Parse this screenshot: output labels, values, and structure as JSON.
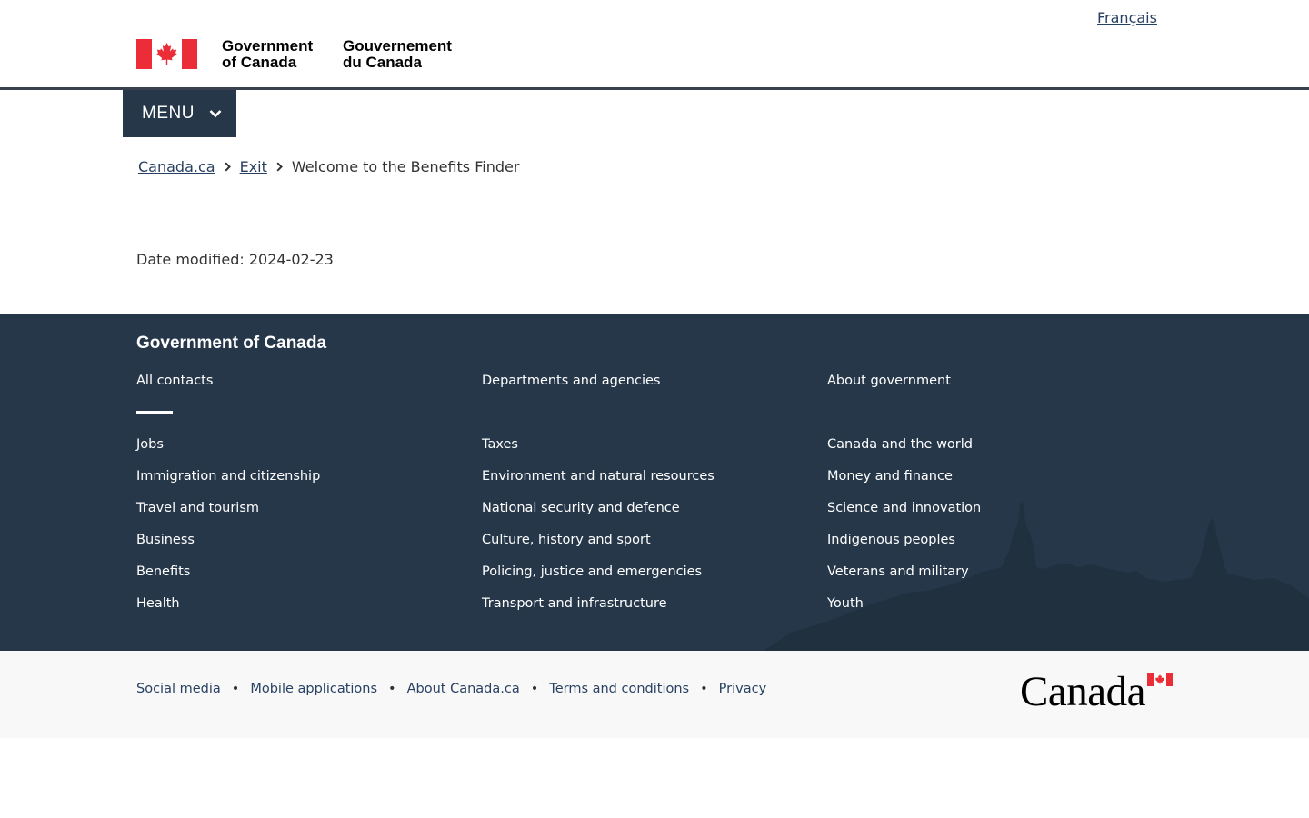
{
  "header": {
    "language_link": "Français",
    "signature_en_line1": "Government",
    "signature_en_line2": "of Canada",
    "signature_fr_line1": "Gouvernement",
    "signature_fr_line2": "du Canada",
    "flag_icon": "canada-flag-icon"
  },
  "menu": {
    "label": "MENU",
    "icon": "chevron-down-icon"
  },
  "breadcrumb": {
    "items": [
      {
        "label": "Canada.ca"
      },
      {
        "label": "Exit"
      },
      {
        "label": "Welcome to the Benefits Finder"
      }
    ]
  },
  "page": {
    "date_label": "Date modified:",
    "date_value": "2024-02-23"
  },
  "footer": {
    "heading": "Government of Canada",
    "contacts": [
      "All contacts",
      "Departments and agencies",
      "About government"
    ],
    "themes": [
      [
        "Jobs",
        "Immigration and citizenship",
        "Travel and tourism",
        "Business",
        "Benefits",
        "Health"
      ],
      [
        "Taxes",
        "Environment and natural resources",
        "National security and defence",
        "Culture, history and sport",
        "Policing, justice and emergencies",
        "Transport and infrastructure"
      ],
      [
        "Canada and the world",
        "Money and finance",
        "Science and innovation",
        "Indigenous peoples",
        "Veterans and military",
        "Youth"
      ]
    ],
    "sub_links": [
      "Social media",
      "Mobile applications",
      "About Canada.ca",
      "Terms and conditions",
      "Privacy"
    ],
    "wordmark": "Canada"
  },
  "colors": {
    "footer_bg": "#26374a",
    "link": "#284162",
    "flag_red": "#eb2d37",
    "sub_footer_bg": "#f8f8f8"
  }
}
